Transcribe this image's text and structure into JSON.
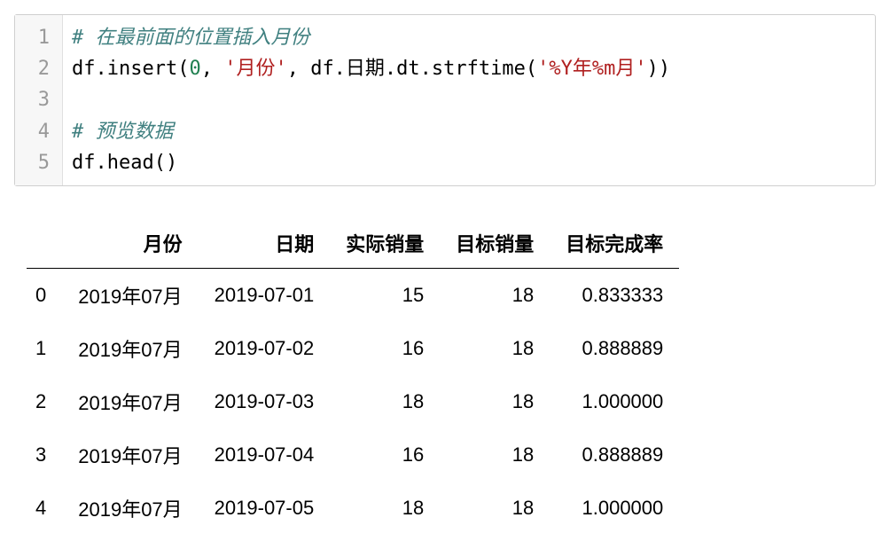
{
  "code": {
    "line1_comment": "# 在最前面的位置插入月份",
    "line2_a": "df.insert(",
    "line2_num": "0",
    "line2_b": ", ",
    "line2_str1": "'月份'",
    "line2_c": ", df.日期.dt.strftime(",
    "line2_str2": "'%Y年%m月'",
    "line2_d": "))",
    "line4_comment": "# 预览数据",
    "line5": "df.head()"
  },
  "table": {
    "columns": [
      "月份",
      "日期",
      "实际销量",
      "目标销量",
      "目标完成率"
    ],
    "rows": [
      {
        "idx": "0",
        "month": "2019年07月",
        "date": "2019-07-01",
        "actual": "15",
        "target": "18",
        "rate": "0.833333"
      },
      {
        "idx": "1",
        "month": "2019年07月",
        "date": "2019-07-02",
        "actual": "16",
        "target": "18",
        "rate": "0.888889"
      },
      {
        "idx": "2",
        "month": "2019年07月",
        "date": "2019-07-03",
        "actual": "18",
        "target": "18",
        "rate": "1.000000"
      },
      {
        "idx": "3",
        "month": "2019年07月",
        "date": "2019-07-04",
        "actual": "16",
        "target": "18",
        "rate": "0.888889"
      },
      {
        "idx": "4",
        "month": "2019年07月",
        "date": "2019-07-05",
        "actual": "18",
        "target": "18",
        "rate": "1.000000"
      }
    ]
  },
  "chart_data": {
    "type": "table",
    "columns": [
      "月份",
      "日期",
      "实际销量",
      "目标销量",
      "目标完成率"
    ],
    "index": [
      0,
      1,
      2,
      3,
      4
    ],
    "data": [
      [
        "2019年07月",
        "2019-07-01",
        15,
        18,
        0.833333
      ],
      [
        "2019年07月",
        "2019-07-02",
        16,
        18,
        0.888889
      ],
      [
        "2019年07月",
        "2019-07-03",
        18,
        18,
        1.0
      ],
      [
        "2019年07月",
        "2019-07-04",
        16,
        18,
        0.888889
      ],
      [
        "2019年07月",
        "2019-07-05",
        18,
        18,
        1.0
      ]
    ]
  }
}
